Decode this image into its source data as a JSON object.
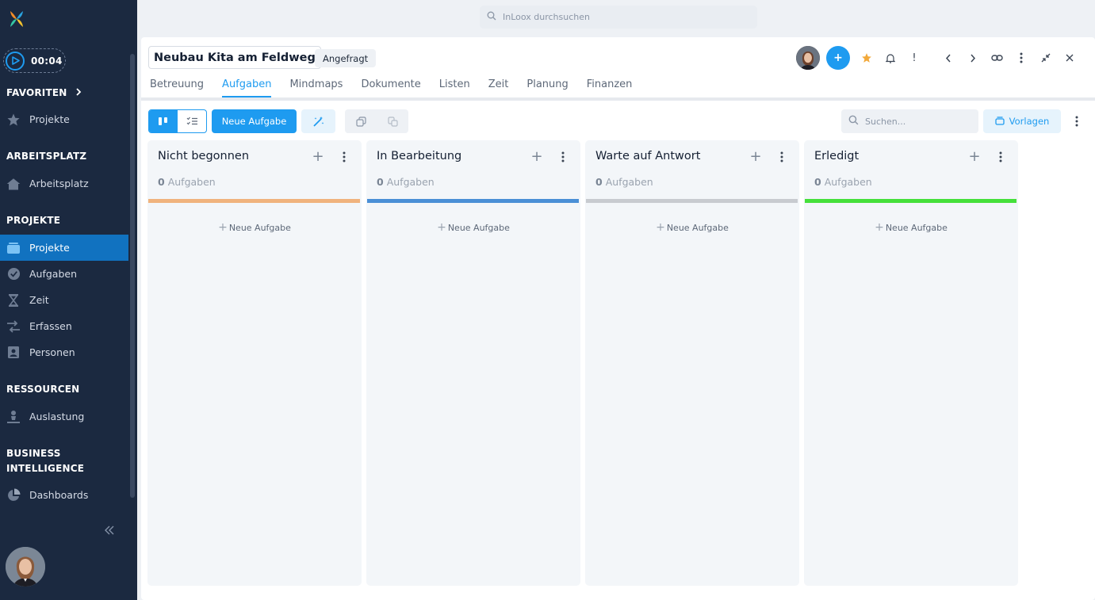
{
  "timer": {
    "time": "00:04"
  },
  "sidebar": {
    "favorites": {
      "title": "FAVORITEN",
      "items": [
        {
          "label": "Projekte",
          "icon": "star-icon"
        }
      ]
    },
    "workspace": {
      "title": "ARBEITSPLATZ",
      "items": [
        {
          "label": "Arbeitsplatz",
          "icon": "home-icon"
        }
      ]
    },
    "projects": {
      "title": "PROJEKTE",
      "items": [
        {
          "label": "Projekte",
          "icon": "folder-icon",
          "active": true
        },
        {
          "label": "Aufgaben",
          "icon": "check-circle-icon"
        },
        {
          "label": "Zeit",
          "icon": "hourglass-icon"
        },
        {
          "label": "Erfassen",
          "icon": "transfer-icon"
        },
        {
          "label": "Personen",
          "icon": "contact-card-icon"
        }
      ]
    },
    "resources": {
      "title": "RESSOURCEN",
      "items": [
        {
          "label": "Auslastung",
          "icon": "person-chart-icon"
        }
      ]
    },
    "bi": {
      "title_line1": "BUSINESS",
      "title_line2": "INTELLIGENCE",
      "items": [
        {
          "label": "Dashboards",
          "icon": "pie-chart-icon"
        }
      ]
    }
  },
  "top_search": {
    "placeholder": "InLoox durchsuchen"
  },
  "project": {
    "title": "Neubau Kita am Feldweg",
    "status": "Angefragt",
    "tabs": [
      {
        "label": "Betreuung"
      },
      {
        "label": "Aufgaben",
        "active": true
      },
      {
        "label": "Mindmaps"
      },
      {
        "label": "Dokumente"
      },
      {
        "label": "Listen"
      },
      {
        "label": "Zeit"
      },
      {
        "label": "Planung"
      },
      {
        "label": "Finanzen"
      }
    ]
  },
  "header_actions": {
    "add": "+",
    "info": "!"
  },
  "toolbar": {
    "new_task": "Neue Aufgabe",
    "search_placeholder": "Suchen...",
    "templates": "Vorlagen"
  },
  "columns": [
    {
      "title": "Nicht begonnen",
      "count": "0",
      "count_label": "Aufgaben",
      "color": "#f0b37e",
      "new_task": "Neue Aufgabe"
    },
    {
      "title": "In Bearbeitung",
      "count": "0",
      "count_label": "Aufgaben",
      "color": "#4a8fd6",
      "new_task": "Neue Aufgabe"
    },
    {
      "title": "Warte auf Antwort",
      "count": "0",
      "count_label": "Aufgaben",
      "color": "#c8cbd0",
      "new_task": "Neue Aufgabe"
    },
    {
      "title": "Erledigt",
      "count": "0",
      "count_label": "Aufgaben",
      "color": "#45e03a",
      "new_task": "Neue Aufgabe"
    }
  ],
  "colors": {
    "accent": "#1e9bf0",
    "sidebar_bg": "#1b2940",
    "sidebar_active": "#1172c0"
  }
}
